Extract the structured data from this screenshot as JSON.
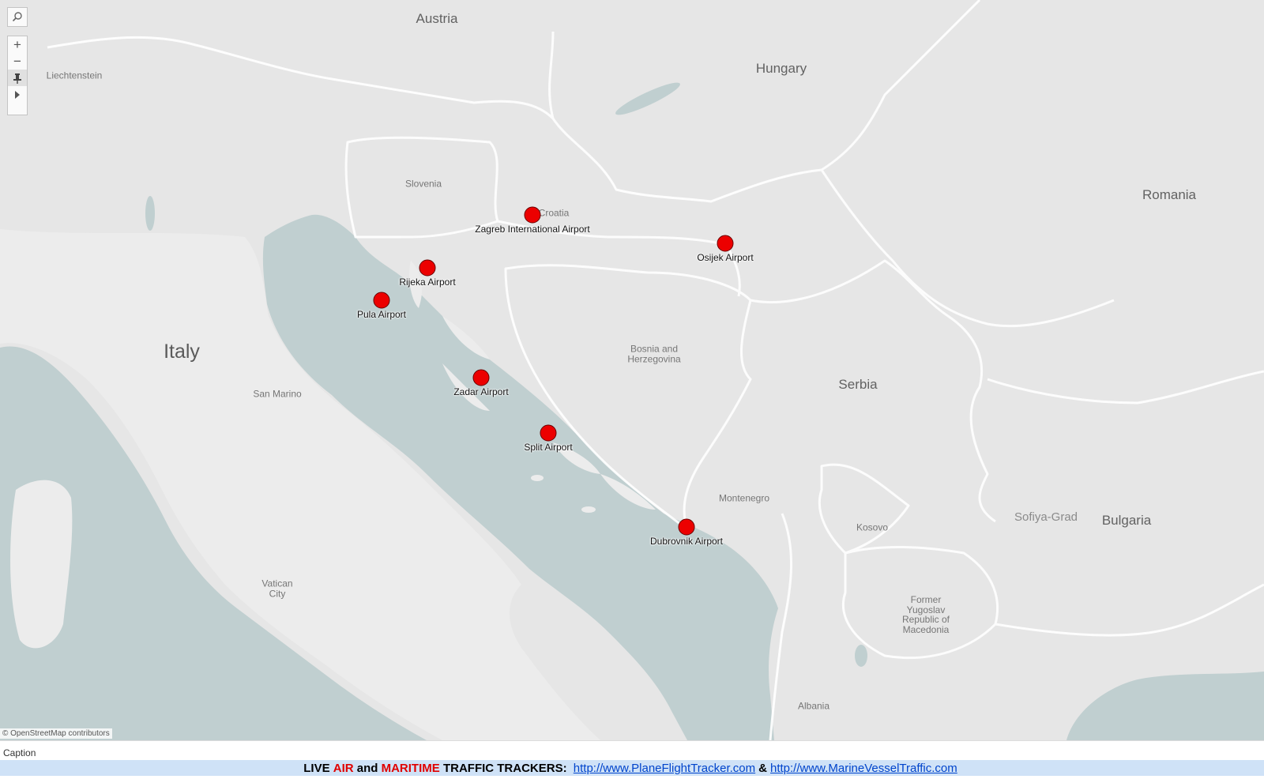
{
  "map": {
    "attribution": "© OpenStreetMap contributors",
    "countries": [
      "Austria",
      "Hungary",
      "Italy",
      "Serbia",
      "Romania",
      "Bulgaria"
    ],
    "small_labels": {
      "liechtenstein": "Liechtenstein",
      "slovenia": "Slovenia",
      "croatia": "Croatia",
      "bosnia": "Bosnia and Herzegovina",
      "san_marino": "San Marino",
      "vatican": "Vatican City",
      "montenegro": "Montenegro",
      "kosovo": "Kosovo",
      "macedonia": "Former Yugoslav Republic of Macedonia",
      "albania": "Albania",
      "sofia": "Sofiya-Grad"
    },
    "airports": [
      "Zagreb International Airport",
      "Osijek Airport",
      "Rijeka Airport",
      "Pula Airport",
      "Zadar Airport",
      "Split Airport",
      "Dubrovnik Airport"
    ],
    "marker_color": "#ec0000"
  },
  "controls": {
    "search_icon": "magnifier-icon",
    "zoom_in": "+",
    "zoom_out": "−",
    "pin_icon": "pin-icon",
    "expand_icon": "play-arrow-icon"
  },
  "caption": {
    "title": "Caption",
    "footer_live": "LIVE",
    "footer_air": "AIR",
    "footer_and": "and",
    "footer_maritime": "MARITIME",
    "footer_trackers": "TRAFFIC TRACKERS:",
    "link1": "http://www.PlaneFlightTracker.com",
    "amp": "&",
    "link2": "http://www.MarineVesselTraffic.com"
  }
}
